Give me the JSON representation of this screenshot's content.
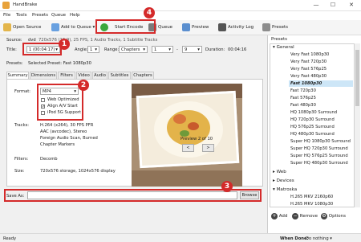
{
  "window": {
    "title": "HandBrake",
    "minimize": "—",
    "maximize": "☐",
    "close": "✕"
  },
  "menu": [
    "File",
    "Tools",
    "Presets",
    "Queue",
    "Help"
  ],
  "toolbar": {
    "open_source": "Open Source",
    "add_to_queue": "Add to Queue",
    "add_to_queue_caret": "▾",
    "start_encode": "Start Encode",
    "queue": "Queue",
    "preview": "Preview",
    "activity_log": "Activity Log",
    "presets": "Presets"
  },
  "source": {
    "label": "Source:",
    "value": "dvd",
    "info": "720x576 (16:9), 25 FPS, 1 Audio Tracks, 1 Subtitle Tracks"
  },
  "title_row": {
    "title_label": "Title:",
    "title_value": "1 (00:04:17)",
    "angle_label": "Angle:",
    "angle_value": "1",
    "range_label": "Range:",
    "range_value": "Chapters",
    "range_start": "1",
    "range_sep": "-",
    "range_end": "9",
    "duration_label": "Duration:",
    "duration_value": "00:04:16"
  },
  "presets_row": {
    "label": "Presets:",
    "value": "Selected Preset: Fast 1080p30"
  },
  "tabs": [
    "Summary",
    "Dimensions",
    "Filters",
    "Video",
    "Audio",
    "Subtitles",
    "Chapters"
  ],
  "summary": {
    "format_label": "Format:",
    "format_value": "MP4",
    "web_optimized": "Web Optimized",
    "align_av": "Align A/V Start",
    "ipod": "iPod 5G Support",
    "tracks_label": "Tracks:",
    "tracks": [
      "H.264 (x264), 30 FPS PFR",
      "AAC (avcodec), Stereo",
      "Foreign Audio Scan, Burned",
      "Chapter Markers"
    ],
    "filters_label": "Filters:",
    "filters_value": "Decomb",
    "size_label": "Size:",
    "size_value": "720x576 storage, 1024x576 display",
    "preview_caption": "Preview 2 of 10",
    "prev_btn": "<",
    "next_btn": ">"
  },
  "save": {
    "label": "Save As:",
    "value": "",
    "browse": "Browse"
  },
  "presets_panel": {
    "header": "Presets",
    "groups": [
      {
        "name": "General",
        "expanded": true,
        "items": [
          "Very Fast 1080p30",
          "Very Fast 720p30",
          "Very Fast 576p25",
          "Very Fast 480p30",
          "Fast 1080p30",
          "Fast 720p30",
          "Fast 576p25",
          "Fast 480p30",
          "HQ 1080p30 Surround",
          "HQ 720p30 Surround",
          "HQ 576p25 Surround",
          "HQ 480p30 Surround",
          "Super HQ 1080p30 Surround",
          "Super HQ 720p30 Surround",
          "Super HQ 576p25 Surround",
          "Super HQ 480p30 Surround"
        ]
      },
      {
        "name": "Web",
        "expanded": false,
        "items": []
      },
      {
        "name": "Devices",
        "expanded": false,
        "items": []
      },
      {
        "name": "Matroska",
        "expanded": true,
        "items": [
          "H.265 MKV 2160p60",
          "H.265 MKV 1080p30"
        ]
      }
    ],
    "selected": "Fast 1080p30",
    "add": "Add",
    "remove": "Remove",
    "options": "Options"
  },
  "status": {
    "left": "Ready",
    "when_done_label": "When Done:",
    "when_done_value": "Do nothing"
  },
  "callouts": [
    "1",
    "2",
    "3",
    "4"
  ],
  "colors": {
    "callout": "#d42a2a",
    "selection": "#cde6f7",
    "start_green": "#3ca73c"
  }
}
